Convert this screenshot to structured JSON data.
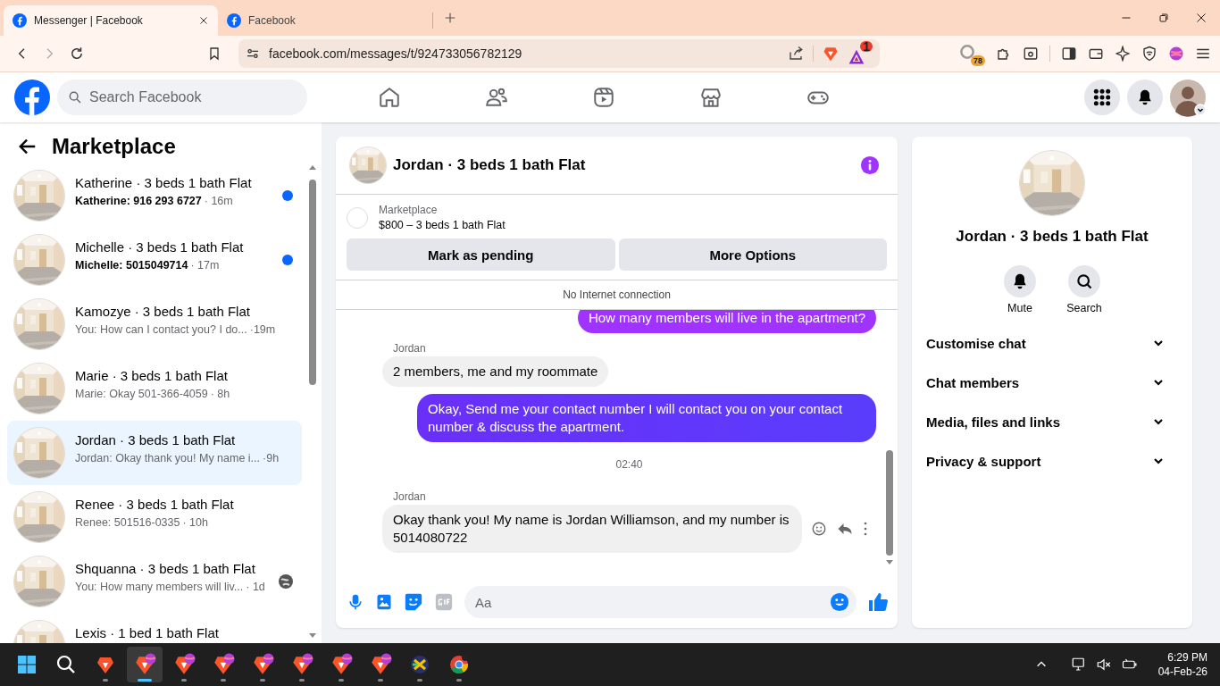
{
  "browser": {
    "tabs": [
      {
        "title": "Messenger | Facebook",
        "selected": true
      },
      {
        "title": "Facebook",
        "selected": false
      }
    ],
    "url": "facebook.com/messages/t/924733056782129",
    "rewards_badge": "1",
    "extension_badge": "78"
  },
  "header": {
    "search_placeholder": "Search Facebook"
  },
  "sidebar": {
    "title": "Marketplace",
    "conversations": [
      {
        "name": "Katherine · 3 beds 1 bath Flat",
        "preview": "Katherine: 916 293 6727",
        "time": "· 16m",
        "unread": true,
        "selected": false,
        "read_receipt": false
      },
      {
        "name": "Michelle · 3 beds 1 bath Flat",
        "preview": "Michelle: 5015049714",
        "time": "· 17m",
        "unread": true,
        "selected": false,
        "read_receipt": false
      },
      {
        "name": "Kamozye · 3 beds 1 bath Flat",
        "preview": "You: How can I contact you? I do...",
        "time": "·19m",
        "unread": false,
        "selected": false,
        "read_receipt": false
      },
      {
        "name": "Marie · 3 beds 1 bath Flat",
        "preview": "Marie: Okay 501-366-4059",
        "time": "· 8h",
        "unread": false,
        "selected": false,
        "read_receipt": false
      },
      {
        "name": "Jordan · 3 beds 1 bath Flat",
        "preview": "Jordan: Okay thank you! My name i...",
        "time": "·9h",
        "unread": false,
        "selected": true,
        "read_receipt": false
      },
      {
        "name": "Renee · 3 beds 1 bath Flat",
        "preview": "Renee: 501516-0335",
        "time": "· 10h",
        "unread": false,
        "selected": false,
        "read_receipt": false
      },
      {
        "name": "Shquanna · 3 beds 1 bath Flat",
        "preview": "You: How many members will liv...",
        "time": "· 1d",
        "unread": false,
        "selected": false,
        "read_receipt": true
      },
      {
        "name": "Lexis · 1 bed 1 bath Flat",
        "selected": false
      }
    ]
  },
  "chat": {
    "title": "Jordan · 3 beds 1 bath Flat",
    "listing": {
      "label": "Marketplace",
      "title": "$800 – 3 beds 1 bath Flat"
    },
    "buttons": [
      "Mark as pending",
      "More Options"
    ],
    "notice": "No Internet connection",
    "messages": [
      {
        "kind": "outgoing",
        "text": "How many members will live in the apartment?"
      },
      {
        "kind": "incoming",
        "sender": "Jordan",
        "text": "2 members, me and my roommate",
        "hovered": false
      },
      {
        "kind": "outgoing",
        "text": "Okay, Send me your contact number I will contact you on your contact number & discuss the apartment.",
        "hovered": false
      },
      {
        "kind": "time",
        "text": "02:40"
      },
      {
        "kind": "incoming",
        "sender": "Jordan",
        "text": "Okay thank you! My name is Jordan Williamson, and my number is 5014080722",
        "hovered": true
      }
    ],
    "composer_placeholder": "Aa"
  },
  "details": {
    "name": "Jordan · 3 beds 1 bath Flat",
    "actions": [
      {
        "kind": "mute",
        "label": "Mute"
      },
      {
        "kind": "search",
        "label": "Search"
      }
    ],
    "sections": [
      {
        "label": "Customise chat",
        "expanded": false
      },
      {
        "label": "Chat members",
        "expanded": false
      },
      {
        "label": "Media, files and links",
        "expanded": false
      },
      {
        "label": "Privacy & support",
        "expanded": false
      }
    ]
  },
  "taskbar": {
    "apps": [
      {
        "kind": "start",
        "active": false
      },
      {
        "kind": "search",
        "active": false
      },
      {
        "kind": "shield",
        "active": false
      },
      {
        "kind": "shield_profile",
        "active": true
      },
      {
        "kind": "shield_profile",
        "active": false
      },
      {
        "kind": "shield_profile",
        "active": false
      },
      {
        "kind": "shield_profile",
        "active": false
      },
      {
        "kind": "shield_profile",
        "active": false
      },
      {
        "kind": "shield_profile",
        "active": false
      },
      {
        "kind": "shield_profile",
        "active": false
      },
      {
        "kind": "round",
        "active": false
      },
      {
        "kind": "wheel",
        "active": false
      }
    ],
    "time": "6:29 PM",
    "date": "04-Feb-26"
  }
}
